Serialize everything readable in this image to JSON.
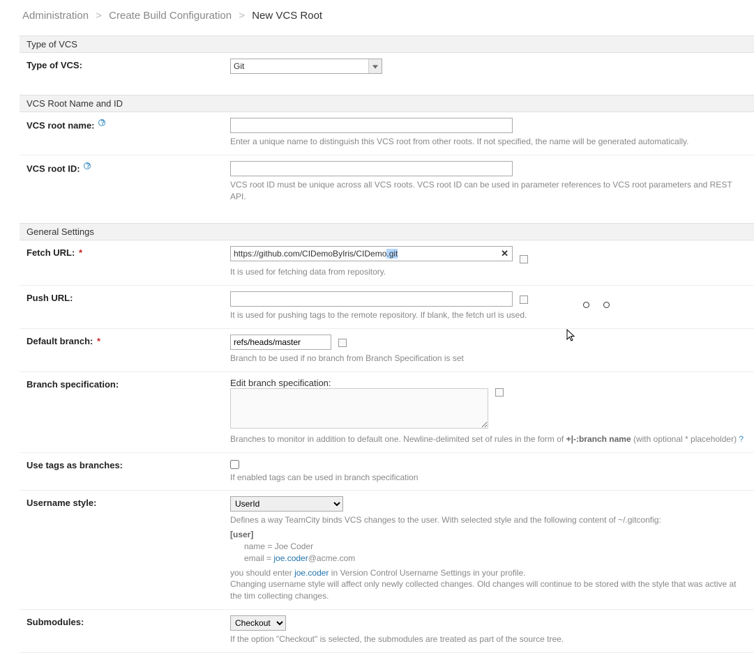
{
  "breadcrumb": {
    "item1": "Administration",
    "item2": "Create Build Configuration",
    "current": "New VCS Root"
  },
  "sections": {
    "typeOfVcs": "Type of VCS",
    "nameAndId": "VCS Root Name and ID",
    "general": "General Settings"
  },
  "labels": {
    "typeOfVcs": "Type of VCS:",
    "rootName": "VCS root name:",
    "rootId": "VCS root ID:",
    "fetchUrl": "Fetch URL:",
    "pushUrl": "Push URL:",
    "defaultBranch": "Default branch:",
    "branchSpec": "Branch specification:",
    "useTags": "Use tags as branches:",
    "usernameStyle": "Username style:",
    "submodules": "Submodules:"
  },
  "values": {
    "vcsType": "Git",
    "rootName": "",
    "rootId": "",
    "fetchUrlPrefix": "https://github.com/CIDemoByIris/CIDemo",
    "fetchUrlSuffix": ".git",
    "pushUrl": "",
    "defaultBranch": "refs/heads/master",
    "branchSpecHeading": "Edit branch specification:",
    "branchSpecText": "",
    "useTagsChecked": false,
    "usernameStyle": "UserId",
    "submodules": "Checkout"
  },
  "hints": {
    "rootName": "Enter a unique name to distinguish this VCS root from other roots. If not specified, the name will be generated automatically.",
    "rootId": "VCS root ID must be unique across all VCS roots. VCS root ID can be used in parameter references to VCS root parameters and REST API.",
    "fetchUrl": "It is used for fetching data from repository.",
    "pushUrl": "It is used for pushing tags to the remote repository. If blank, the fetch url is used.",
    "defaultBranch": "Branch to be used if no branch from Branch Specification is set",
    "branchSpecPrefix": "Branches to monitor in addition to default one. Newline-delimited set of rules in the form of ",
    "branchSpecPattern": "+|-:branch name",
    "branchSpecSuffix": " (with optional * placeholder)",
    "useTags": "If enabled tags can be used in branch specification",
    "usernameStyle1": "Defines a way TeamCity binds VCS changes to the user. With selected style and the following content of ~/.gitconfig:",
    "gitUser": "[user]",
    "gitName": "name = Joe Coder",
    "gitEmailPre": "email = ",
    "gitEmailLink": "joe.coder",
    "gitEmailPost": "@acme.com",
    "usernameStyle2a": "you should enter ",
    "usernameStyle2Link": "joe.coder",
    "usernameStyle2b": " in Version Control Username Settings in your profile.",
    "usernameStyle3": "Changing username style will affect only newly collected changes. Old changes will continue to be stored with the style that was active at the tim collecting changes.",
    "submodules": "If the option \"Checkout\" is selected, the submodules are treated as part of the source tree."
  }
}
